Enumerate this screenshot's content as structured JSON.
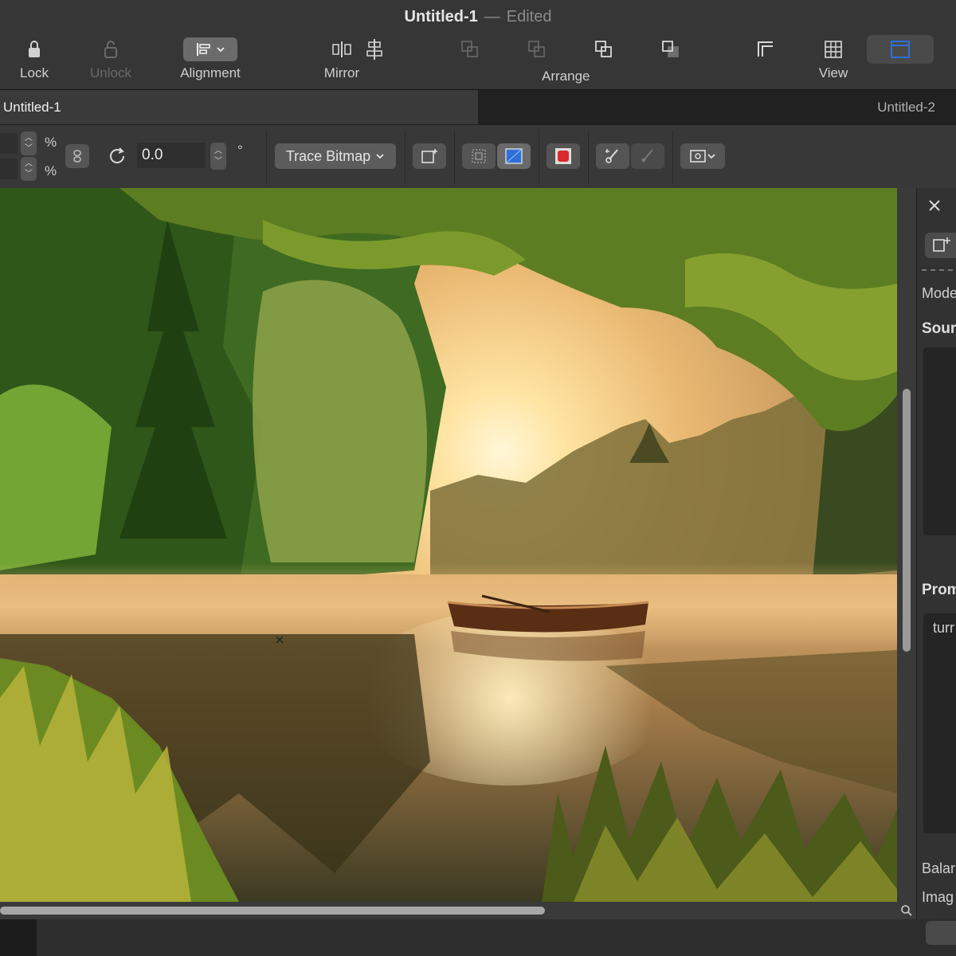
{
  "window": {
    "title": "Untitled-1",
    "separator": "—",
    "status": "Edited"
  },
  "toolbar": {
    "lock": "Lock",
    "unlock": "Unlock",
    "alignment": "Alignment",
    "mirror": "Mirror",
    "arrange": "Arrange",
    "view": "View"
  },
  "tabs": [
    {
      "label": "Untitled-1"
    },
    {
      "label": "Untitled-2"
    }
  ],
  "properties": {
    "pct_symbol": "%",
    "rotation_value": "0.0",
    "degree_symbol": "°",
    "trace_bitmap": "Trace Bitmap"
  },
  "panel": {
    "mode_label": "Mode",
    "source_label": "Sour",
    "prompt_label": "Prom",
    "prompt_text": "turr",
    "balance_label": "Balar",
    "image_label": "Imag"
  },
  "colors": {
    "chrome": "#363636",
    "accent_blue": "#2f6fd8",
    "record_red": "#d92b2b"
  },
  "icons": [
    "lock-icon",
    "unlock-icon",
    "alignment-icon",
    "mirror-icon",
    "arrange-icons",
    "view-grid-icon",
    "close-icon",
    "zoom-icon"
  ]
}
